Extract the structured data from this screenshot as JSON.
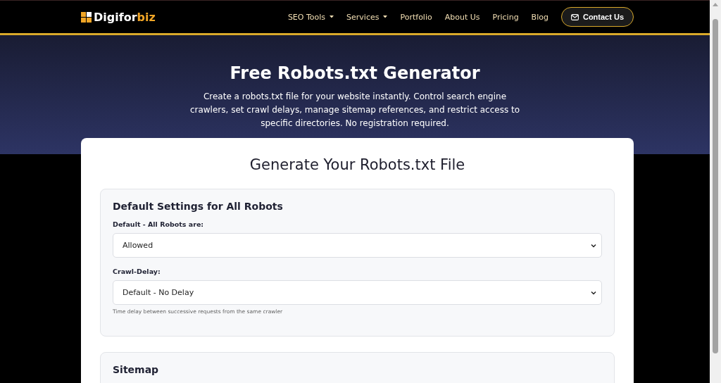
{
  "header": {
    "logo": {
      "main": "Digifor",
      "accent": "biz"
    },
    "nav": [
      {
        "label": "SEO Tools",
        "dropdown": true
      },
      {
        "label": "Services",
        "dropdown": true
      },
      {
        "label": "Portfolio",
        "dropdown": false
      },
      {
        "label": "About Us",
        "dropdown": false
      },
      {
        "label": "Pricing",
        "dropdown": false
      },
      {
        "label": "Blog",
        "dropdown": false
      }
    ],
    "contact_button": "Contact Us"
  },
  "hero": {
    "title": "Free Robots.txt Generator",
    "description": "Create a robots.txt file for your website instantly. Control search engine crawlers, set crawl delays, manage sitemap references, and restrict access to specific directories. No registration required."
  },
  "card": {
    "title": "Generate Your Robots.txt File",
    "sections": [
      {
        "title": "Default Settings for All Robots",
        "fields": [
          {
            "label": "Default - All Robots are:",
            "value": "Allowed"
          },
          {
            "label": "Crawl-Delay:",
            "value": "Default - No Delay",
            "hint": "Time delay between successive requests from the same crawler"
          }
        ]
      },
      {
        "title": "Sitemap"
      }
    ]
  }
}
